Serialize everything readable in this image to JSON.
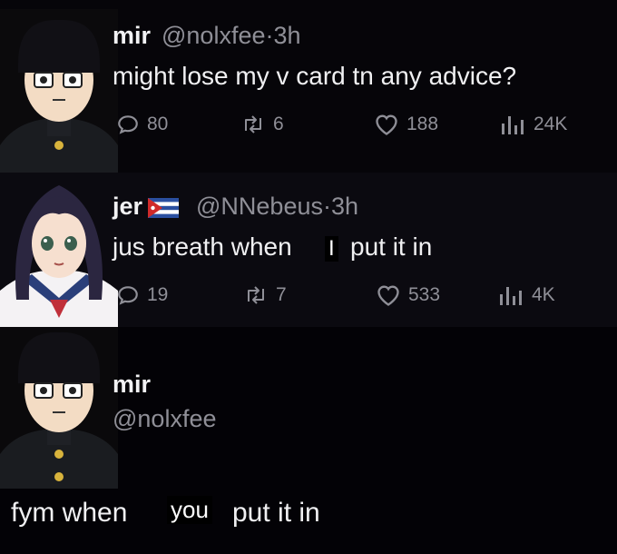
{
  "tweets": [
    {
      "name": "mir",
      "handle": "@nolxfee",
      "separator": "·",
      "time": "3h",
      "text": "might lose my v card tn any advice?",
      "stats": {
        "replies": "80",
        "reposts": "6",
        "likes": "188",
        "views": "24K"
      }
    },
    {
      "name": "jer",
      "handle": "@NNebeus",
      "separator": "·",
      "time": "3h",
      "text_before": "jus breath when",
      "text_inserted": "I",
      "text_after": "put it in",
      "stats": {
        "replies": "19",
        "reposts": "7",
        "likes": "533",
        "views": "4K"
      }
    },
    {
      "name": "mir",
      "handle": "@nolxfee",
      "text_before": "fym when",
      "text_inserted": "you",
      "text_after": "put it in"
    }
  ],
  "icons": {
    "reply": "reply-icon",
    "repost": "repost-icon",
    "like": "heart-icon",
    "views": "views-icon",
    "flag": "cuba-flag-icon"
  },
  "colors": {
    "background": "#050408",
    "muted": "#8f8f97",
    "text": "#f0f0f2"
  }
}
